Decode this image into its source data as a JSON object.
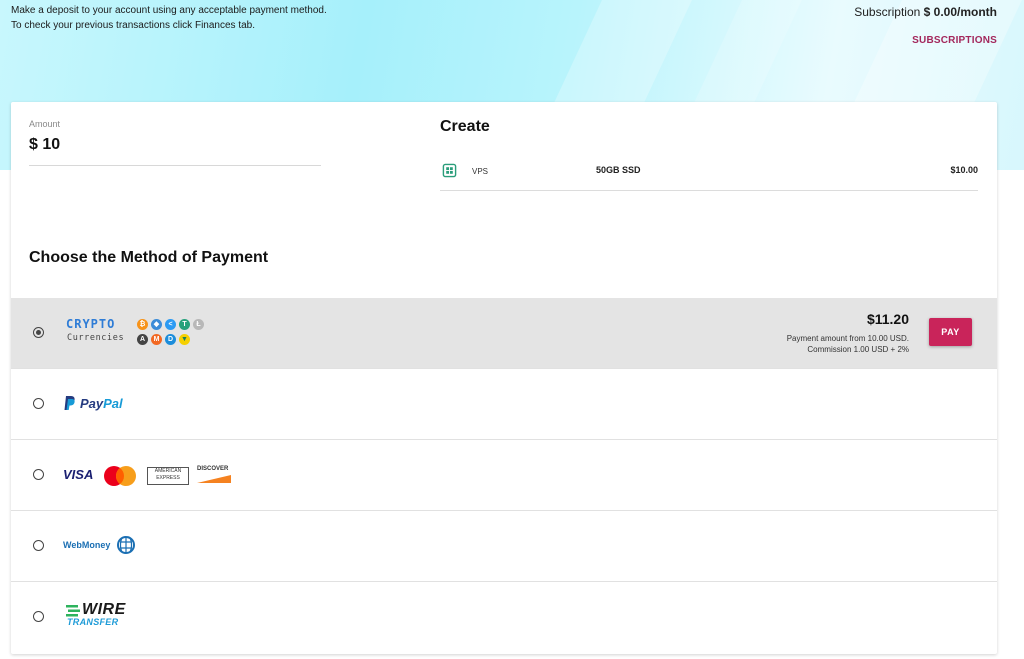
{
  "header": {
    "intro_line1": "Make a deposit to your account using any acceptable payment method.",
    "intro_line2": "To check your previous transactions click Finances tab.",
    "subscription_label": "Subscription",
    "subscription_value": "$ 0.00/month",
    "subscriptions_link": "SUBSCRIPTIONS"
  },
  "amount": {
    "label": "Amount",
    "value": "$ 10"
  },
  "create": {
    "title": "Create",
    "item": {
      "icon": "chip-icon",
      "type": "VPS",
      "description": "50GB SSD",
      "price": "$10.00"
    }
  },
  "payment": {
    "title": "Choose the Method of Payment",
    "selected": "crypto",
    "crypto": {
      "word": "CRYPTO",
      "sub": "Currencies",
      "amount": "$11.20",
      "note_line1": "Payment amount from 10.00 USD.",
      "note_line2": "Commission 1.00 USD + 2%",
      "pay_label": "PAY",
      "coins_row1": [
        "bitcoin-icon",
        "ethereum-icon",
        "nano-icon",
        "tether-icon",
        "litecoin-icon"
      ],
      "coins_row2": [
        "aeternity-icon",
        "monero-icon",
        "dash-icon",
        "shield-coin-icon"
      ]
    },
    "paypal": {
      "pay": "Pay",
      "pal": "Pal"
    },
    "cards": {
      "visa": "VISA",
      "amex_1": "AMERICAN",
      "amex_2": "EXPRESS",
      "discover": "DISCOVER"
    },
    "webmoney": {
      "label": "WebMoney"
    },
    "wire": {
      "big": "WIRE",
      "small": "TRANSFER"
    }
  },
  "colors": {
    "accent": "#c9245a",
    "link": "#a3275c",
    "selected_row": "#e4e4e4"
  }
}
